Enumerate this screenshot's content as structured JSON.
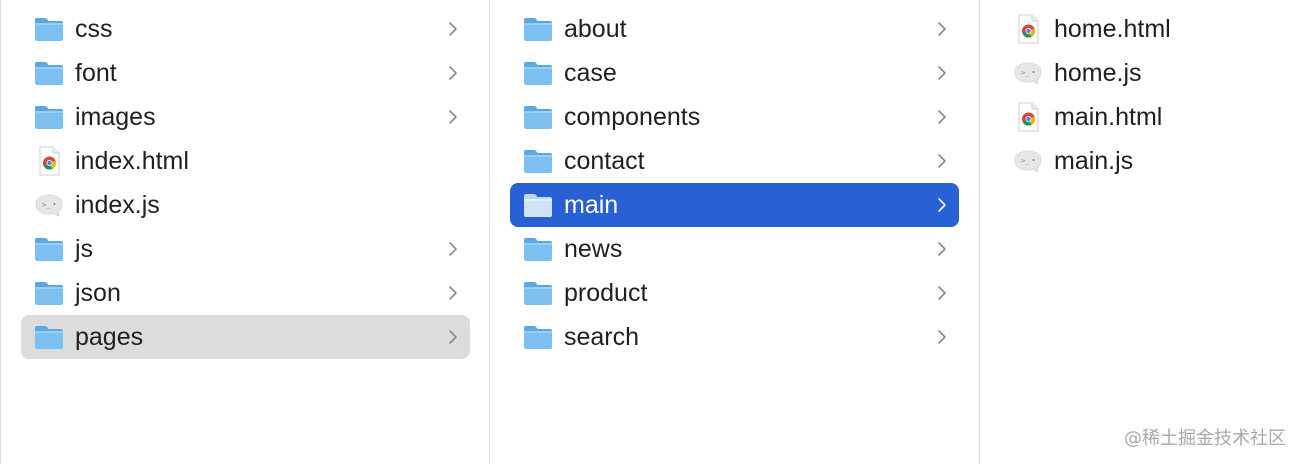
{
  "columns": [
    {
      "items": [
        {
          "name": "css",
          "type": "folder",
          "chevron": true
        },
        {
          "name": "font",
          "type": "folder",
          "chevron": true
        },
        {
          "name": "images",
          "type": "folder",
          "chevron": true
        },
        {
          "name": "index.html",
          "type": "html",
          "chevron": false
        },
        {
          "name": "index.js",
          "type": "js",
          "chevron": false
        },
        {
          "name": "js",
          "type": "folder",
          "chevron": true
        },
        {
          "name": "json",
          "type": "folder",
          "chevron": true
        },
        {
          "name": "pages",
          "type": "folder",
          "chevron": true,
          "selected": "inactive"
        }
      ]
    },
    {
      "items": [
        {
          "name": "about",
          "type": "folder",
          "chevron": true
        },
        {
          "name": "case",
          "type": "folder",
          "chevron": true
        },
        {
          "name": "components",
          "type": "folder",
          "chevron": true
        },
        {
          "name": "contact",
          "type": "folder",
          "chevron": true
        },
        {
          "name": "main",
          "type": "folder",
          "chevron": true,
          "selected": "active"
        },
        {
          "name": "news",
          "type": "folder",
          "chevron": true
        },
        {
          "name": "product",
          "type": "folder",
          "chevron": true
        },
        {
          "name": "search",
          "type": "folder",
          "chevron": true
        }
      ]
    },
    {
      "items": [
        {
          "name": "home.html",
          "type": "html",
          "chevron": false
        },
        {
          "name": "home.js",
          "type": "js",
          "chevron": false
        },
        {
          "name": "main.html",
          "type": "html",
          "chevron": false
        },
        {
          "name": "main.js",
          "type": "js",
          "chevron": false
        }
      ]
    }
  ],
  "colors": {
    "selected_active": "#2860d6",
    "selected_inactive": "#dcdcdc",
    "folder": "#6fb6ee"
  },
  "watermark": "@稀土掘金技术社区"
}
